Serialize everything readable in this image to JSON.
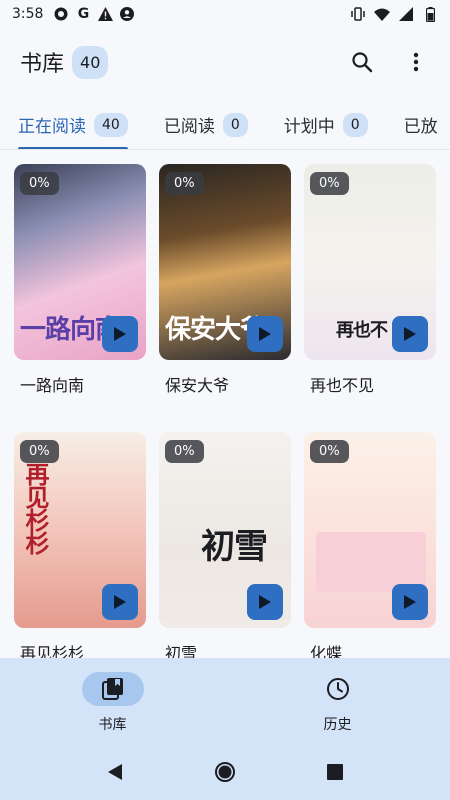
{
  "status_bar": {
    "time": "3:58",
    "left_icons": [
      "podcast-app-icon",
      "google-icon",
      "warning-icon",
      "account-icon"
    ],
    "right_icons": [
      "vibrate-icon",
      "wifi-icon",
      "signal-icon",
      "battery-icon"
    ]
  },
  "app_bar": {
    "title": "书库",
    "count": "40",
    "actions": [
      "search-icon",
      "more-vert-icon"
    ]
  },
  "tabs": [
    {
      "label": "正在阅读",
      "count": "40",
      "active": true
    },
    {
      "label": "已阅读",
      "count": "0",
      "active": false
    },
    {
      "label": "计划中",
      "count": "0",
      "active": false
    },
    {
      "label": "已放",
      "count": "",
      "active": false
    }
  ],
  "books": [
    {
      "title": "一路向南",
      "progress": "0%",
      "cover_text": "一路向南",
      "cover_text_color": "#5b3fa8"
    },
    {
      "title": "保安大爷",
      "progress": "0%",
      "cover_text": "保安大爷",
      "cover_text_color": "#ffffff"
    },
    {
      "title": "再也不见",
      "progress": "0%",
      "cover_text": "再也不",
      "cover_text_color": "#1c1d22"
    },
    {
      "title": "再见杉杉",
      "progress": "0%",
      "cover_text": "再见杉杉",
      "cover_text_color": "#b01f2a"
    },
    {
      "title": "初雪",
      "progress": "0%",
      "cover_text": "初雪",
      "cover_text_color": "#1c1d22"
    },
    {
      "title": "化蝶",
      "progress": "0%",
      "cover_text": "",
      "cover_text_color": "#1c1d22"
    }
  ],
  "bottom_nav": [
    {
      "label": "书库",
      "icon": "library-icon",
      "active": true
    },
    {
      "label": "历史",
      "icon": "history-icon",
      "active": false
    }
  ],
  "system_nav": [
    "back-icon",
    "home-icon",
    "recents-icon"
  ],
  "colors": {
    "accent": "#2b66b3",
    "badge_bg": "#cfe1f7",
    "nav_bg": "#d3e3f8",
    "play_button": "#2f6fc2"
  }
}
